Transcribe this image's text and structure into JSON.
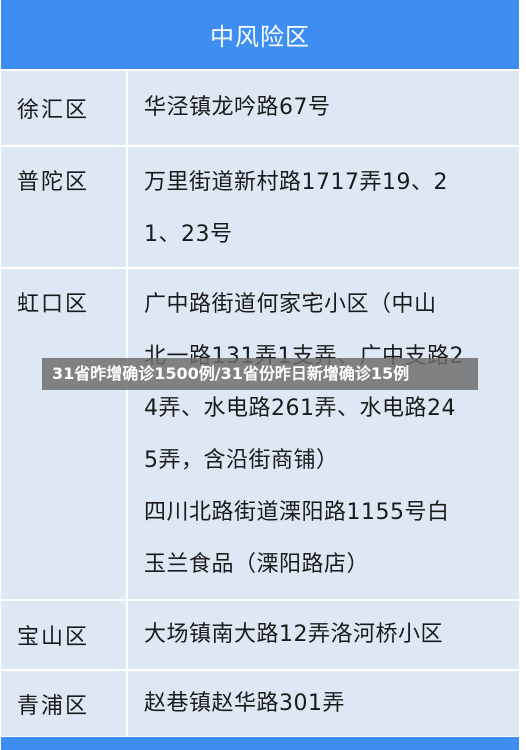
{
  "header": {
    "title": "中风险区"
  },
  "rows": [
    {
      "district": "徐汇区",
      "address_lines": [
        "华泾镇龙吟路67号"
      ]
    },
    {
      "district": "普陀区",
      "address_lines": [
        "万里街道新村路1717弄19、2",
        "1、23号"
      ]
    },
    {
      "district": "虹口区",
      "address_lines": [
        "广中路街道何家宅小区（中山",
        "北一路131弄1支弄、广中支路2",
        "4弄、水电路261弄、水电路24",
        "5弄，含沿街商铺）",
        "四川北路街道溧阳路1155号白",
        "玉兰食品（溧阳路店）"
      ]
    },
    {
      "district": "宝山区",
      "address_lines": [
        "大场镇南大路12弄洛河桥小区"
      ]
    },
    {
      "district": "青浦区",
      "address_lines": [
        "赵巷镇赵华路301弄"
      ]
    }
  ],
  "overlay": {
    "caption": "31省昨增确诊1500例/31省份昨日新增确诊15例"
  },
  "colors": {
    "header_bg": "#3d8ef0",
    "cell_bg": "#dde8f4",
    "text": "#1a1a1a"
  }
}
